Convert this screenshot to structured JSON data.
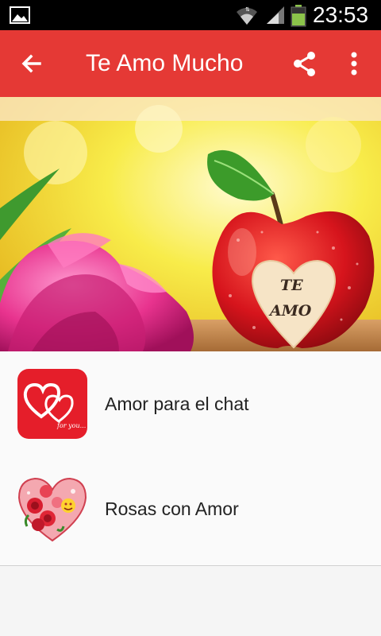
{
  "status_bar": {
    "time": "23:53",
    "icons": [
      "gallery-icon",
      "wifi-icon",
      "signal-icon",
      "battery-icon"
    ],
    "battery_color": "#8bc34a"
  },
  "app_bar": {
    "title": "Te Amo Mucho",
    "background": "#e53935",
    "icons": [
      "back-arrow-icon",
      "share-icon",
      "more-vert-icon"
    ]
  },
  "banner": {
    "heart_text_line1": "TE",
    "heart_text_line2": "AMO"
  },
  "list": {
    "items": [
      {
        "label": "Amor para el chat",
        "icon": "double-heart-app-icon",
        "icon_caption": "for you..."
      },
      {
        "label": "Rosas con Amor",
        "icon": "rose-heart-app-icon"
      }
    ]
  }
}
